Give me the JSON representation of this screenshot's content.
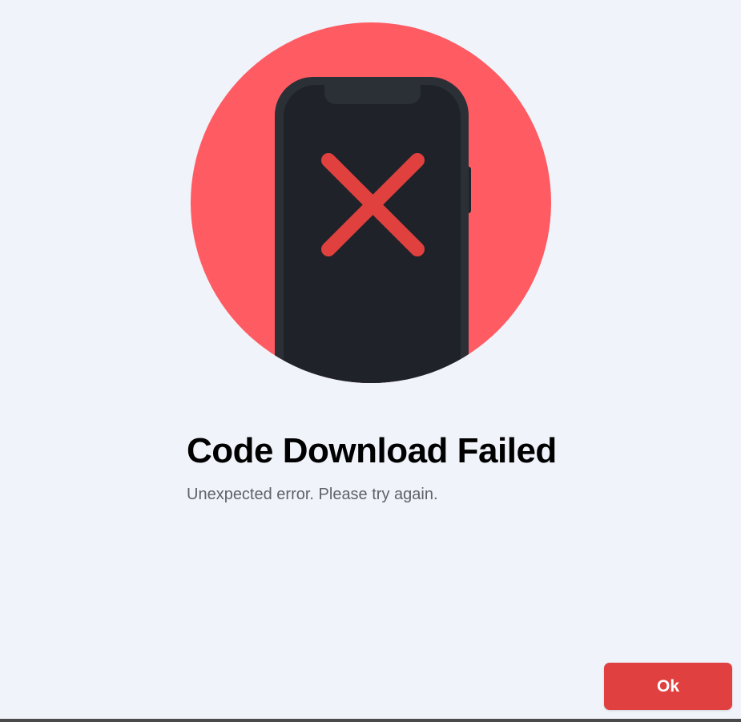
{
  "dialog": {
    "title": "Code Download Failed",
    "message": "Unexpected error. Please try again.",
    "ok_label": "Ok",
    "illustration_icon": "phone-error-icon"
  },
  "colors": {
    "background": "#f0f3f9",
    "circle": "#ff5b63",
    "phone_body": "#1f2329",
    "phone_screen_edge": "#2b2f36",
    "cross": "#e0413f",
    "button": "#e0403f",
    "title": "#000000",
    "message": "#5f6368"
  }
}
